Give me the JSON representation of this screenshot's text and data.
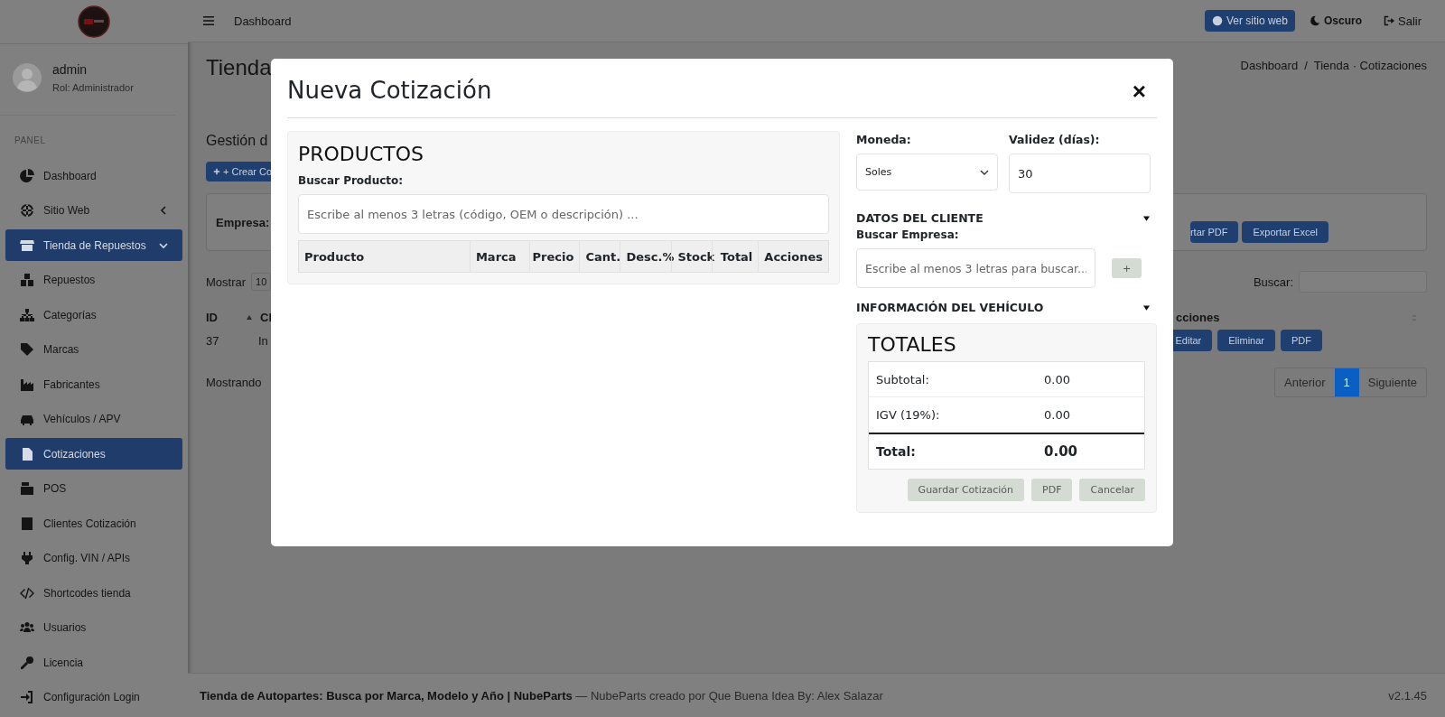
{
  "sidebar": {
    "user": {
      "name": "admin",
      "role": "Rol: Administrador"
    },
    "section": "PANEL",
    "items": [
      {
        "label": "Dashboard",
        "kind": "link",
        "selected": false
      },
      {
        "label": "Sitio Web",
        "kind": "group",
        "expanded": false,
        "selected": false
      },
      {
        "label": "Tienda de Repuestos",
        "kind": "group",
        "expanded": true,
        "selected": true
      },
      {
        "label": "Repuestos",
        "kind": "link",
        "selected": false
      },
      {
        "label": "Categorías",
        "kind": "link",
        "selected": false
      },
      {
        "label": "Marcas",
        "kind": "link",
        "selected": false
      },
      {
        "label": "Fabricantes",
        "kind": "link",
        "selected": false
      },
      {
        "label": "Vehículos / APV",
        "kind": "link",
        "selected": false
      },
      {
        "label": "Cotizaciones",
        "kind": "link",
        "selected": true
      },
      {
        "label": "POS",
        "kind": "link",
        "selected": false
      },
      {
        "label": "Clientes Cotización",
        "kind": "link",
        "selected": false
      },
      {
        "label": "Config. VIN / APIs",
        "kind": "link",
        "selected": false
      },
      {
        "label": "Shortcodes tienda",
        "kind": "link",
        "selected": false
      },
      {
        "label": "Usuarios",
        "kind": "link",
        "selected": false
      },
      {
        "label": "Licencia",
        "kind": "link",
        "selected": false
      },
      {
        "label": "Configuración Login",
        "kind": "link",
        "selected": false
      }
    ]
  },
  "header": {
    "title": "Dashboard",
    "buttons": [
      {
        "label": "Ver sitio web",
        "kind": "primary"
      },
      {
        "label": "Oscuro",
        "kind": "theme"
      },
      {
        "label": "Salir",
        "kind": "logout"
      }
    ]
  },
  "page": {
    "title": "Tienda",
    "breadcrumb": {
      "items": [
        "Dashboard",
        "Tienda · Cotizaciones"
      ],
      "separator": "/"
    },
    "subtitle": "Gestión d",
    "create_button": "+ Crear Co",
    "filter_label": "Empresa:",
    "export_buttons": [
      "rtar PDF",
      "Exportar Excel"
    ],
    "show_label": "Mostrar",
    "show_value": "10",
    "search_label": "Buscar:",
    "table": {
      "columns": [
        "ID",
        "Cl",
        "cciones"
      ],
      "rows": [
        {
          "cells": [
            "37",
            "In"
          ],
          "actions": [
            "Editar",
            "Eliminar",
            "PDF"
          ]
        }
      ]
    },
    "info": "Mostrando",
    "pagination": [
      {
        "label": "Anterior",
        "selected": false
      },
      {
        "label": "1",
        "selected": true
      },
      {
        "label": "Siguiente",
        "selected": false
      }
    ]
  },
  "modal": {
    "title": "Nueva Cotización",
    "close": "×",
    "products": {
      "title": "PRODUCTOS",
      "search_label": "Buscar Producto:",
      "search_placeholder": "Escribe al menos 3 letras (código, OEM o descripción) ...",
      "columns": [
        "Producto",
        "Marca",
        "Precio",
        "Cant.",
        "Desc.%",
        "Stock",
        "Total",
        "Acciones"
      ]
    },
    "currency": {
      "label": "Moneda:",
      "value": "Soles"
    },
    "validity": {
      "label": "Validez (días):",
      "value": "30"
    },
    "client": {
      "title": "DATOS DEL CLIENTE",
      "search_label": "Buscar Empresa:",
      "placeholder": "Escribe al menos 3 letras para buscar...",
      "add_button": {
        "label": "+",
        "disabled": true
      }
    },
    "vehicle": {
      "title": "INFORMACIÓN DEL VEHÍCULO"
    },
    "totals": {
      "title": "TOTALES",
      "rows": [
        {
          "label": "Subtotal:",
          "value": "0.00",
          "kind": "line"
        },
        {
          "label": "IGV (19%):",
          "value": "0.00",
          "kind": "line"
        },
        {
          "label": "Total:",
          "value": "0.00",
          "kind": "grand"
        }
      ],
      "buttons": [
        {
          "label": "Guardar Cotización",
          "disabled": true
        },
        {
          "label": "PDF",
          "disabled": true
        },
        {
          "label": "Cancelar",
          "disabled": true
        }
      ]
    }
  },
  "footer": {
    "text": "**Tienda de Autopartes: Busca por Marca, Modelo y Año | NubeParts** — NubeParts creado por Que Buena Idea By: Alex Salazar",
    "version": "v2.1.45"
  }
}
